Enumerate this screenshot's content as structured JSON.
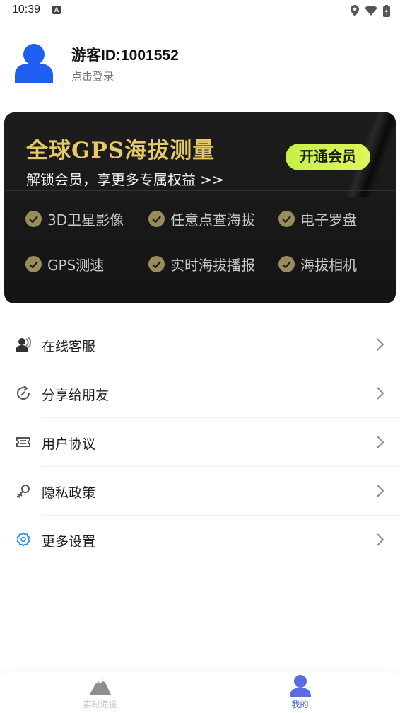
{
  "status_bar": {
    "time": "10:39",
    "notif_letter": "A"
  },
  "profile": {
    "user_id": "游客ID:1001552",
    "login_prompt": "点击登录"
  },
  "banner": {
    "title": "全球GPS海拔测量",
    "subtitle": "解锁会员，享更多专属权益 >>",
    "cta_label": "开通会员",
    "features": [
      "3D卫星影像",
      "任意点查海拔",
      "电子罗盘",
      "GPS测速",
      "实时海拔播报",
      "海拔相机"
    ]
  },
  "menu": {
    "items": [
      {
        "label": "在线客服",
        "icon": "customer-service-icon"
      },
      {
        "label": "分享给朋友",
        "icon": "share-icon"
      },
      {
        "label": "用户协议",
        "icon": "ticket-icon"
      },
      {
        "label": "隐私政策",
        "icon": "key-icon"
      },
      {
        "label": "更多设置",
        "icon": "gear-icon"
      }
    ]
  },
  "bottom_nav": {
    "tabs": [
      {
        "label": "实时海拔",
        "icon": "mountain-icon",
        "active": false
      },
      {
        "label": "我的",
        "icon": "person-icon",
        "active": true
      }
    ]
  },
  "colors": {
    "accent": "#4659d1",
    "avatar_blue": "#1f5ef0",
    "gold": "#e6c867",
    "cta_green": "#d6f452"
  }
}
